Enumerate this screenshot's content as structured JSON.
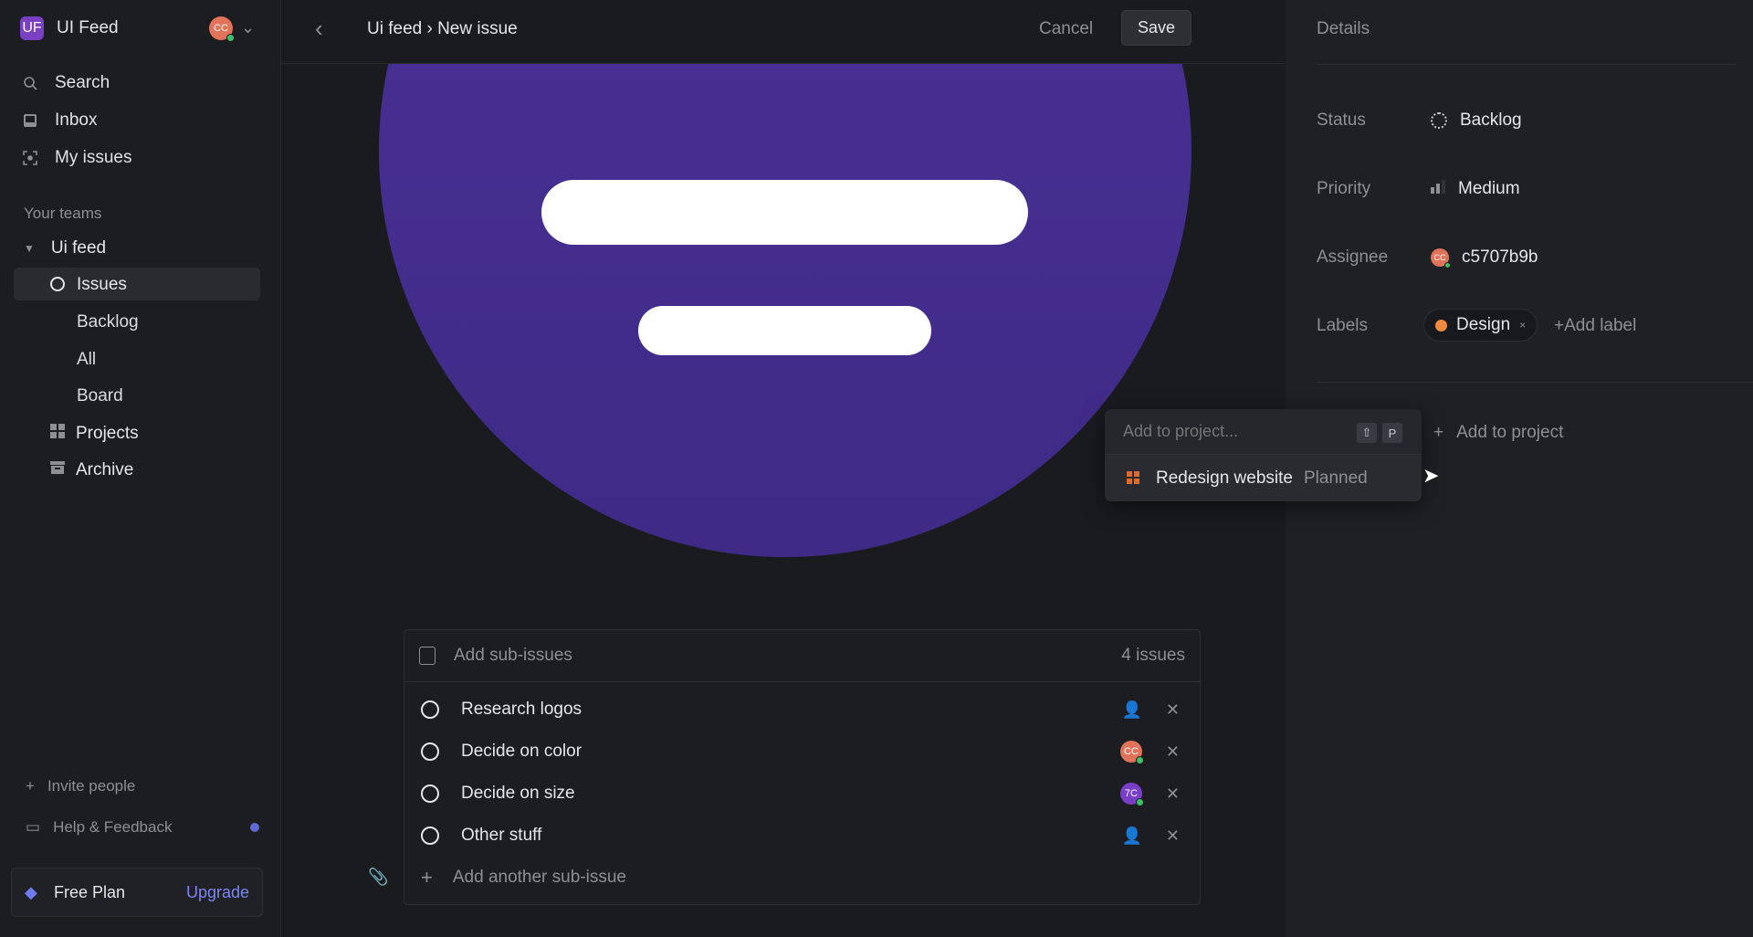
{
  "sidebar": {
    "workspace": {
      "initials": "UF",
      "name": "UI Feed",
      "user_initials": "CC"
    },
    "nav": [
      {
        "label": "Search",
        "icon": "search-icon"
      },
      {
        "label": "Inbox",
        "icon": "inbox-icon"
      },
      {
        "label": "My issues",
        "icon": "my-issues-icon"
      }
    ],
    "teams_heading": "Your teams",
    "team": {
      "name": "Ui feed",
      "items": [
        {
          "label": "Issues"
        },
        {
          "label": "Backlog"
        },
        {
          "label": "All"
        },
        {
          "label": "Board"
        },
        {
          "label": "Projects"
        },
        {
          "label": "Archive"
        }
      ]
    },
    "invite": "Invite people",
    "help": "Help & Feedback",
    "plan": {
      "label": "Free Plan",
      "upgrade": "Upgrade"
    }
  },
  "header": {
    "breadcrumb": "Ui feed › New issue",
    "cancel": "Cancel",
    "save": "Save"
  },
  "subissues": {
    "header": "Add sub-issues",
    "count": "4 issues",
    "items": [
      {
        "title": "Research logos",
        "assignee": null
      },
      {
        "title": "Decide on color",
        "assignee": "CC",
        "assignee_color": "#e0735a"
      },
      {
        "title": "Decide on size",
        "assignee": "7C",
        "assignee_color": "#7a3fc9"
      },
      {
        "title": "Other stuff",
        "assignee": null
      }
    ],
    "add_another": "Add another sub-issue"
  },
  "project_dropdown": {
    "placeholder": "Add to project...",
    "shortcut": [
      "⇧",
      "P"
    ],
    "options": [
      {
        "name": "Redesign website",
        "status": "Planned"
      }
    ]
  },
  "details": {
    "title": "Details",
    "status": {
      "label": "Status",
      "value": "Backlog"
    },
    "priority": {
      "label": "Priority",
      "value": "Medium"
    },
    "assignee": {
      "label": "Assignee",
      "value": "c5707b9b",
      "initials": "CC"
    },
    "labels": {
      "label": "Labels",
      "items": [
        {
          "name": "Design",
          "color": "#f08a3c"
        }
      ],
      "add": "Add label"
    },
    "project": {
      "add": "Add to project"
    }
  },
  "colors": {
    "accent": "#5e6ad2",
    "hero": "#4a2f96"
  }
}
